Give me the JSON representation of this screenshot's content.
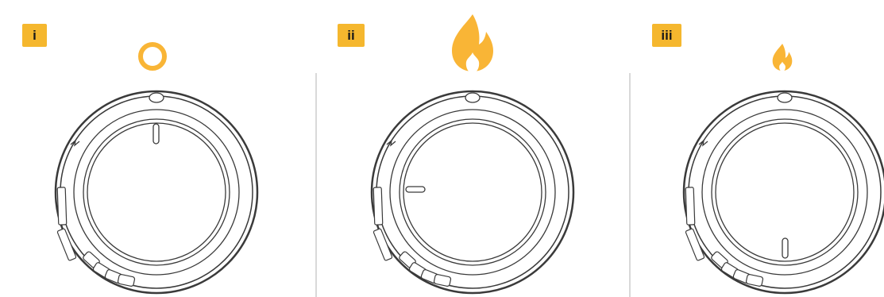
{
  "panels": [
    {
      "label": "i",
      "flame_level": "off",
      "pointer": "up"
    },
    {
      "label": "ii",
      "flame_level": "high",
      "pointer": "left"
    },
    {
      "label": "iii",
      "flame_level": "low",
      "pointer": "down"
    }
  ],
  "colors": {
    "accent": "#f5b72e",
    "flame": "#f9b536",
    "knob_outline": "#3a3a3a",
    "divider": "#d9d9d9"
  },
  "icons": [
    "off-ring-icon",
    "high-flame-icon",
    "low-flame-icon",
    "lightning-icon"
  ]
}
